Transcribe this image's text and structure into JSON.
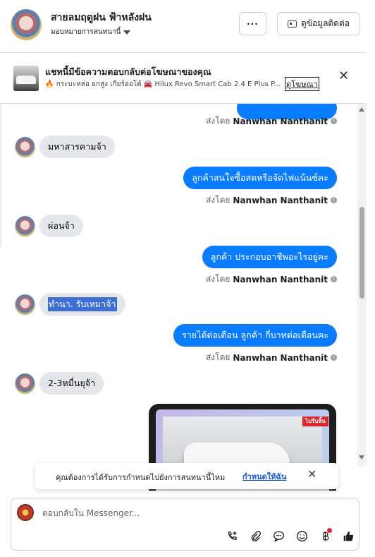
{
  "header": {
    "name": "สายลมฤดูฝน ฟ้าหลังฝน",
    "assign": "มอบหมายการสนทนานี้",
    "more_label": "···",
    "contact_label": "ดูข้อมูลติดต่อ"
  },
  "ad_banner": {
    "title": "แชทนี้มีข้อความตอบกลับต่อโฆษณาของคุณ",
    "subtitle": "🔥 กระบะหล่อ ยกสูง เกียร์ออโต้ 🚘 Hilux Revo Smart Cab 2.4 E Plus P...",
    "link": "ดูโฆษณา",
    "close_icon": "close-icon"
  },
  "messages": [
    {
      "type": "sent_by",
      "sender_prefix": "ส่งโดย",
      "sender": "Nanwhan Nanthanit"
    },
    {
      "type": "in",
      "text": "มหาสารคามจ้า"
    },
    {
      "type": "out",
      "text": "ลูกค้าสนใจซื้อสดหรือจัดไฟแน้นซ์คะ"
    },
    {
      "type": "sent_by",
      "sender_prefix": "ส่งโดย",
      "sender": "Nanwhan Nanthanit"
    },
    {
      "type": "in",
      "text": "ผ่อนจ้า"
    },
    {
      "type": "out",
      "text": "ลูกค้า ประกอบอาชีพอะไรอยู่คะ"
    },
    {
      "type": "sent_by",
      "sender_prefix": "ส่งโดย",
      "sender": "Nanwhan Nanthanit"
    },
    {
      "type": "in",
      "text": "ทำนา. รับเหมาจ้า"
    },
    {
      "type": "out",
      "text": "รายได้ต่อเดือน ลูกค้า กี่บาทต่อเดือนคะ"
    },
    {
      "type": "sent_by",
      "sender_prefix": "ส่งโดย",
      "sender": "Nanwhan Nanthanit"
    },
    {
      "type": "in",
      "text": "2-3หมื่นยุจ้า"
    }
  ],
  "image_message": {
    "tag": "ไปรับลิ้น"
  },
  "toast": {
    "text": "คุณต้องการได้รับการกำหนดไปยังการสนทนานี้ไหม",
    "link": "กำหนดให้ฉัน"
  },
  "composer": {
    "placeholder": "ตอบกลับใน Messenger...",
    "tools": [
      "call-add-icon",
      "attachment-icon",
      "chat-bubble-icon",
      "emoji-icon",
      "baht-payment-icon",
      "thumbs-up-icon"
    ]
  },
  "colors": {
    "outgoing_bubble": "#0a7cff",
    "incoming_bubble": "#e4e6eb",
    "link": "#1457d8"
  }
}
